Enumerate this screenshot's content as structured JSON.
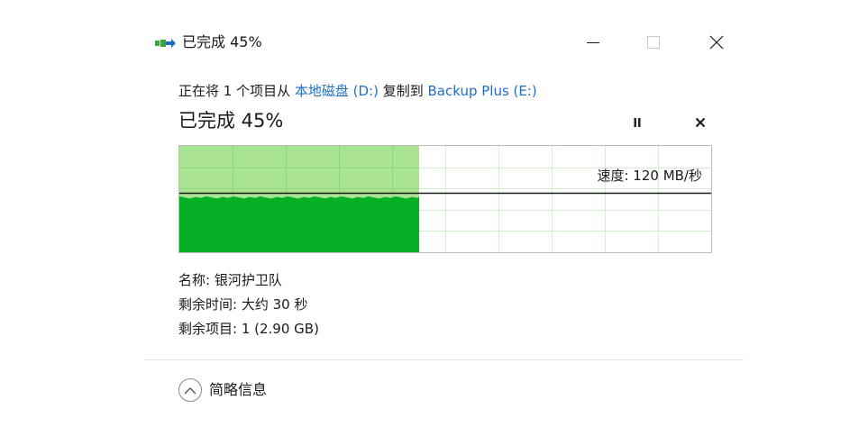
{
  "window": {
    "title": "已完成 45%",
    "icons": {
      "app": "file-move-icon",
      "minimize": "minimize-icon",
      "maximize": "maximize-icon",
      "close": "close-icon"
    }
  },
  "copy": {
    "prefix": "正在将 1 个项目从 ",
    "source": "本地磁盘 (D:)",
    "middle": " 复制到 ",
    "destination": "Backup Plus (E:)"
  },
  "progress": {
    "title": "已完成 45%",
    "percent": 45,
    "pause_icon": "pause-icon",
    "cancel_icon": "cancel-icon"
  },
  "graph": {
    "speed_text": "速度: 120 MB/秒",
    "speed_level": 0.56,
    "colors": {
      "done_area": "#a8e491",
      "speed_fill": "#06b025",
      "grid": "#d3efcf",
      "line": "#1a1a1a"
    }
  },
  "details": {
    "name": "名称: 银河护卫队",
    "time_remaining": "剩余时间: 大约 30 秒",
    "items_remaining": "剩余项目: 1 (2.90 GB)"
  },
  "footer": {
    "toggle_label": "简略信息",
    "toggle_icon": "chevron-up-icon"
  }
}
